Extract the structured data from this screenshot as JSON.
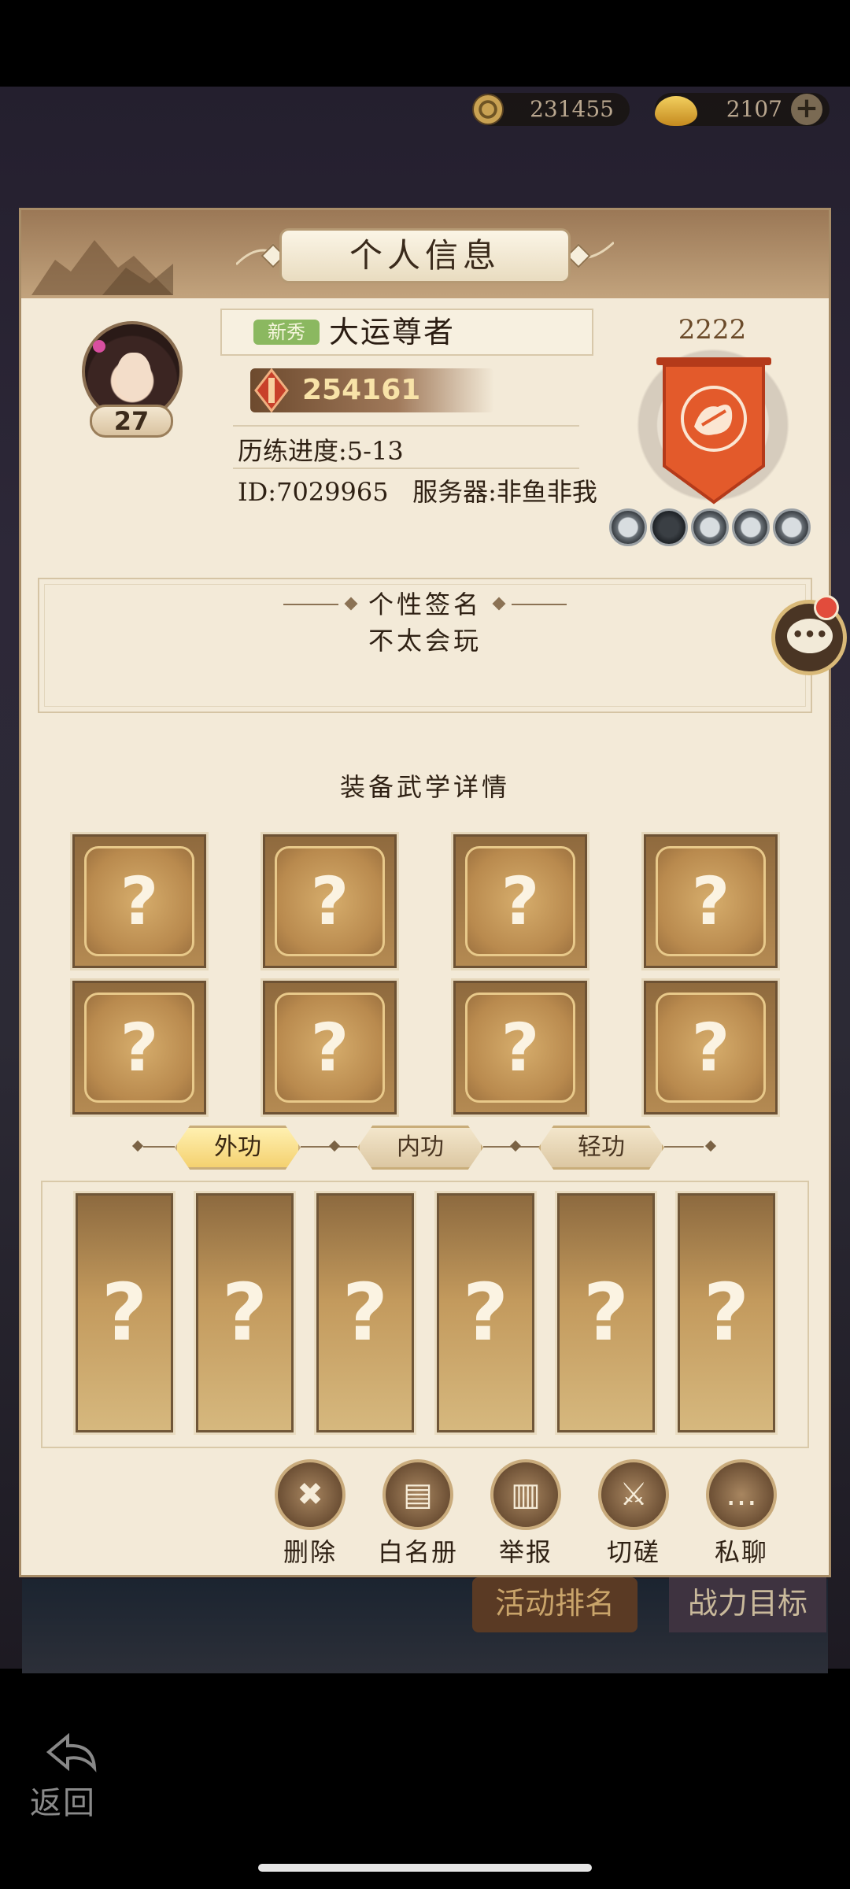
{
  "currency": {
    "coins": "231455",
    "ingots": "2107"
  },
  "panel": {
    "title": "个人信息"
  },
  "player": {
    "level": "27",
    "tag": "新秀",
    "name": "大运尊者",
    "power": "254161",
    "progress": "历练进度:5-13",
    "id_server": "ID:7029965   服务器:非鱼非我"
  },
  "guild": {
    "score": "2222"
  },
  "signature": {
    "title": "个性签名",
    "text": "不太会玩"
  },
  "equipment": {
    "title": "装备武学详情",
    "slot_placeholder": "?",
    "tabs": [
      {
        "label": "外功",
        "active": true
      },
      {
        "label": "内功",
        "active": false
      },
      {
        "label": "轻功",
        "active": false
      }
    ]
  },
  "actions": [
    {
      "label": "删除",
      "icon": "delete-friend-icon"
    },
    {
      "label": "白名册",
      "icon": "whitelist-book-icon"
    },
    {
      "label": "举报",
      "icon": "blacklist-book-icon"
    },
    {
      "label": "切磋",
      "icon": "spar-icon"
    },
    {
      "label": "私聊",
      "icon": "chat-icon"
    }
  ],
  "background": {
    "rank_button": "活动排名",
    "power_goal_button": "战力目标",
    "back": "返回"
  },
  "colors": {
    "panel_bg": "#f3ead8",
    "active_tab": "#f4d170",
    "banner": "#e35a2b",
    "badge": "#e24c3c"
  }
}
